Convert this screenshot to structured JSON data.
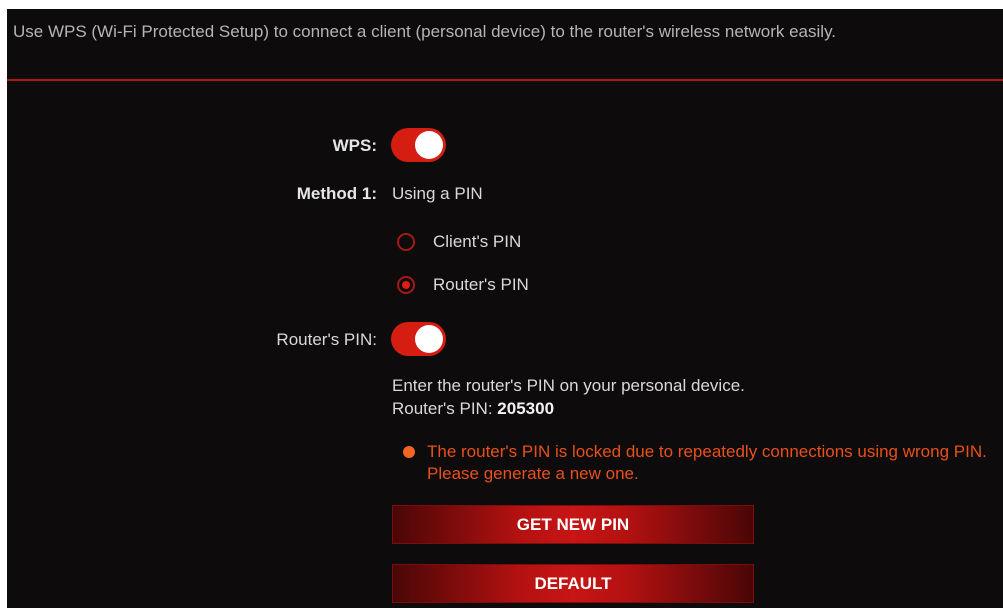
{
  "description": "Use WPS (Wi-Fi Protected Setup) to connect a client (personal device) to the router's wireless network easily.",
  "wps": {
    "label": "WPS",
    "enabled": true
  },
  "method1": {
    "label": "Method 1",
    "value": "Using a PIN",
    "options": [
      {
        "label": "Client's PIN",
        "selected": false
      },
      {
        "label": "Router's PIN",
        "selected": true
      }
    ]
  },
  "routers_pin": {
    "label": "Router's PIN",
    "enabled": true,
    "instruction": "Enter the router's PIN on your personal device.",
    "pin_label": "Router's PIN:",
    "pin_value": "205300"
  },
  "warning": {
    "text": "The router's PIN is locked due to repeatedly connections using wrong PIN. Please generate a new one.",
    "color": "#e8501c"
  },
  "buttons": {
    "get_new_pin": "GET NEW PIN",
    "default": "DEFAULT"
  },
  "colors": {
    "accent": "#d51d12",
    "background": "#0d0b0b"
  },
  "icons": {
    "warning": "warning-dot-icon"
  }
}
